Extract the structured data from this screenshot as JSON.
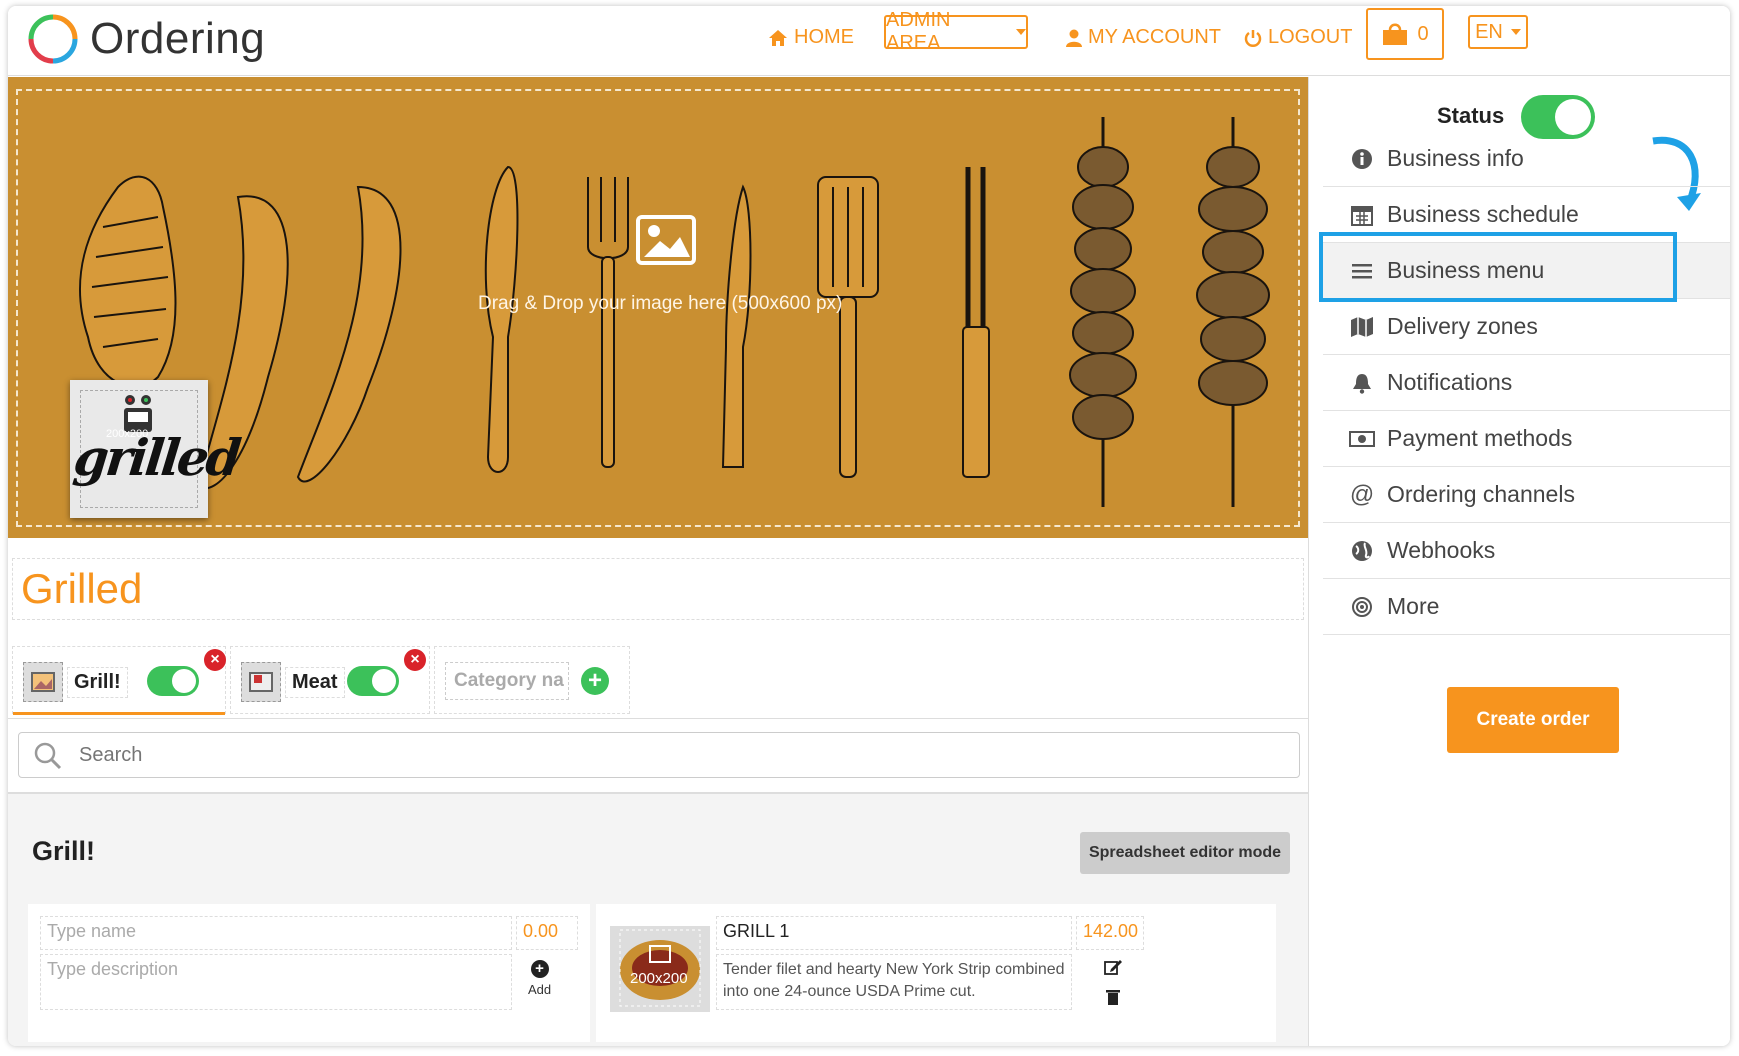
{
  "app": {
    "title": "Ordering"
  },
  "nav": {
    "home": "HOME",
    "admin_area": "ADMIN AREA",
    "my_account": "MY ACCOUNT",
    "logout": "LOGOUT",
    "cart_count": "0",
    "language": "EN"
  },
  "banner": {
    "drop_text": "Drag & Drop your image here (500x600 px)",
    "logo_size": "200x200",
    "logo_word": "grilled"
  },
  "business": {
    "name": "Grilled"
  },
  "categories": [
    {
      "name": "Grill!",
      "enabled": true,
      "active": true
    },
    {
      "name": "Meat",
      "enabled": true,
      "active": false
    }
  ],
  "new_category": {
    "placeholder": "Category na"
  },
  "search": {
    "placeholder": "Search"
  },
  "section": {
    "title": "Grill!",
    "spreadsheet_label": "Spreadsheet editor mode"
  },
  "new_product": {
    "name_placeholder": "Type name",
    "price": "0.00",
    "description_placeholder": "Type description",
    "add_label": "Add"
  },
  "products": [
    {
      "name": "GRILL 1",
      "price": "142.00",
      "description": "Tender filet and hearty New York Strip combined into one 24-ounce USDA Prime cut.",
      "image_size": "200x200"
    }
  ],
  "sidebar": {
    "status_label": "Status",
    "status_on": true,
    "items": [
      {
        "label": "Business info",
        "icon": "info-icon"
      },
      {
        "label": "Business schedule",
        "icon": "calendar-icon"
      },
      {
        "label": "Business menu",
        "icon": "menu-icon",
        "active": true
      },
      {
        "label": "Delivery zones",
        "icon": "map-icon"
      },
      {
        "label": "Notifications",
        "icon": "bell-icon"
      },
      {
        "label": "Payment methods",
        "icon": "money-icon"
      },
      {
        "label": "Ordering channels",
        "icon": "at-icon"
      },
      {
        "label": "Webhooks",
        "icon": "globe-icon"
      },
      {
        "label": "More",
        "icon": "target-icon"
      }
    ],
    "create_order": "Create order"
  },
  "colors": {
    "accent": "#f7941e",
    "toggle": "#3cc15a",
    "highlight": "#1ea1e6",
    "banner": "#c98f31",
    "danger": "#d9232a"
  }
}
